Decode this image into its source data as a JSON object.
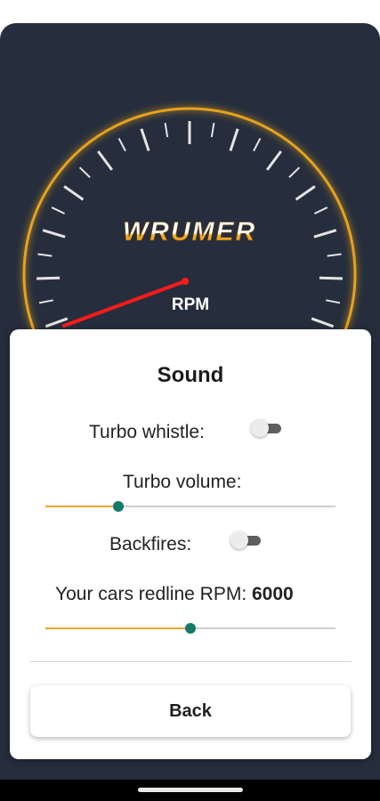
{
  "gauge": {
    "brand": "WRUMER",
    "unit_label": "RPM",
    "needle_fraction": 0.03,
    "arc_color": "#e6a21a",
    "needle_color": "#ff1a1a"
  },
  "dialog": {
    "title": "Sound",
    "turbo_whistle": {
      "label": "Turbo whistle:",
      "enabled": false
    },
    "turbo_volume": {
      "label": "Turbo volume:",
      "value": 0.25
    },
    "backfires": {
      "label": "Backfires:",
      "enabled": false
    },
    "redline": {
      "label": "Your cars redline RPM: ",
      "value": "6000",
      "slider_value": 0.5
    },
    "back_button": "Back"
  },
  "colors": {
    "background": "#262e3d",
    "accent": "#f2a52a",
    "knob": "#137a6c"
  }
}
